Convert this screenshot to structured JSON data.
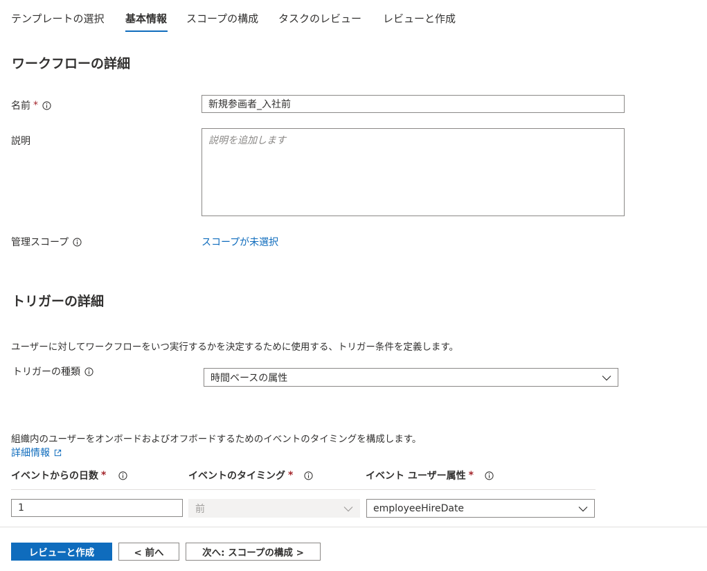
{
  "tabs": [
    {
      "label": "テンプレートの選択"
    },
    {
      "label": "基本情報"
    },
    {
      "label": "スコープの構成"
    },
    {
      "label": "タスクのレビュー"
    },
    {
      "label": "レビューと作成"
    }
  ],
  "workflow_details": {
    "heading": "ワークフローの詳細",
    "name_label": "名前",
    "required_mark": "*",
    "name_value": "新規参画者_入社前",
    "description_label": "説明",
    "description_placeholder": "説明を追加します",
    "scope_label": "管理スコープ",
    "scope_link": "スコープが未選択"
  },
  "trigger_details": {
    "heading": "トリガーの詳細",
    "description": "ユーザーに対してワークフローをいつ実行するかを決定するために使用する、トリガー条件を定義します。",
    "trigger_type_label": "トリガーの種類",
    "trigger_type_value": "時間ベースの属性",
    "timing_description": "組織内のユーザーをオンボードおよびオフボードするためのイベントのタイミングを構成します。",
    "learn_more_link": "詳細情報",
    "columns": {
      "days_label": "イベントからの日数",
      "timing_label": "イベントのタイミング",
      "attribute_label": "イベント ユーザー属性"
    },
    "days_value": "1",
    "timing_value": "前",
    "attribute_value": "employeeHireDate"
  },
  "footer": {
    "review_create": "レビューと作成",
    "previous": "< 前へ",
    "next": "次へ: スコープの構成 >"
  },
  "colors": {
    "accent": "#0f6cbd",
    "required": "#a4262c"
  }
}
